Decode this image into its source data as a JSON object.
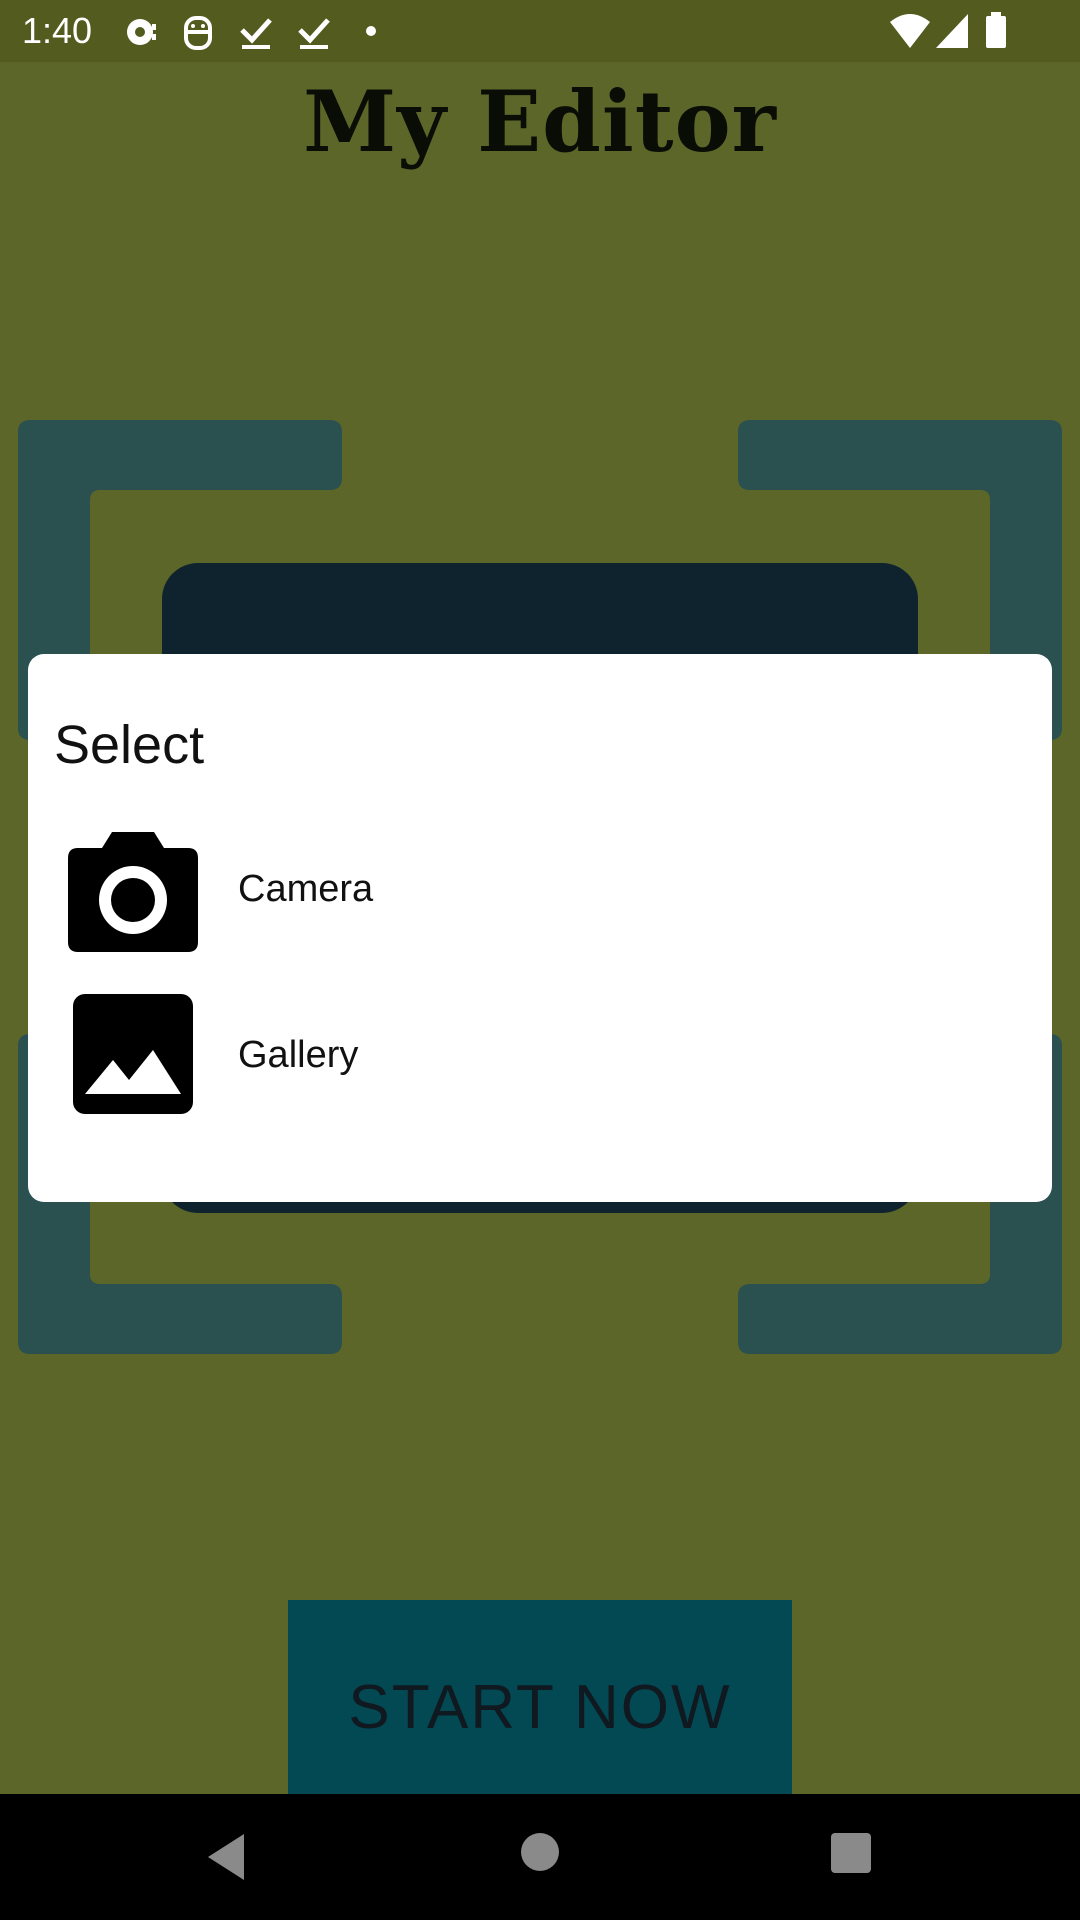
{
  "status_bar": {
    "time": "1:40",
    "icons": [
      "notification-icon",
      "android-icon",
      "download-done-icon",
      "download-done-icon",
      "dot-icon",
      "wifi-icon",
      "signal-icon",
      "battery-icon"
    ]
  },
  "app": {
    "title": "My Editor",
    "start_button_label": "START NOW"
  },
  "dialog": {
    "title": "Select",
    "options": [
      {
        "label": "Camera",
        "icon": "camera-icon"
      },
      {
        "label": "Gallery",
        "icon": "image-icon"
      }
    ]
  },
  "nav_bar": {
    "icons": [
      "back-icon",
      "home-icon",
      "recents-icon"
    ]
  },
  "colors": {
    "scrim_background": "#5d6629",
    "status_bar": "#545b1e",
    "frame_corners": "#2a5050",
    "start_button": "#034954",
    "dialog": "#ffffff"
  }
}
